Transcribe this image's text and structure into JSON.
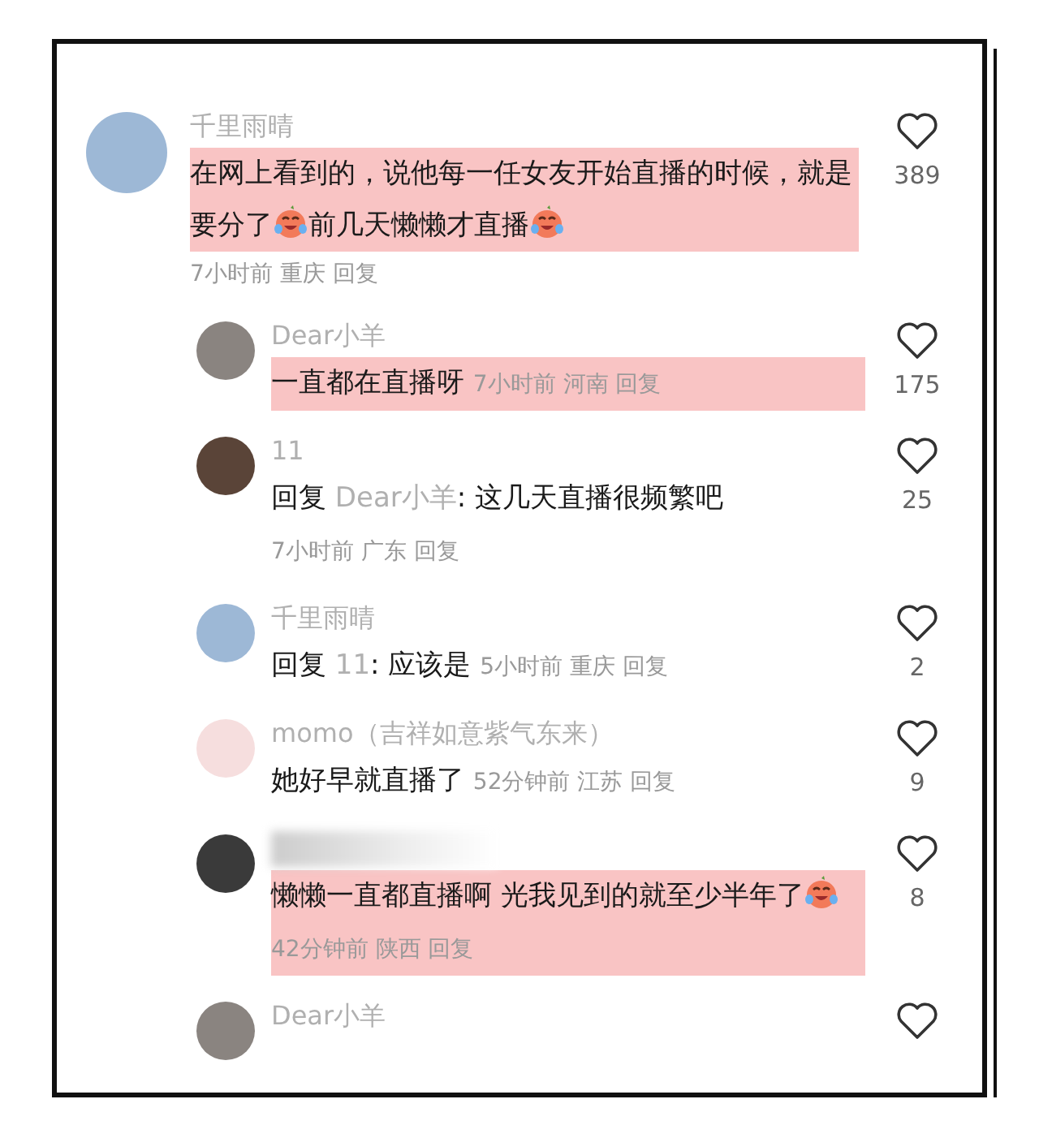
{
  "comments": [
    {
      "user": "千里雨晴",
      "color": "#9db8d6",
      "highlighted": true,
      "segments": [
        {
          "kind": "text",
          "text": "在网上看到的，说他每一任女友开始直播的时候，就是要分了"
        },
        {
          "kind": "emoji"
        },
        {
          "kind": "text",
          "text": "前几天懒懒才直播"
        },
        {
          "kind": "emoji"
        }
      ],
      "time": "7小时前",
      "location": "重庆",
      "reply": "回复",
      "likes": "389",
      "replies": [
        {
          "user": "Dear小羊",
          "color": "#8a8480",
          "highlighted": true,
          "segments": [
            {
              "kind": "text",
              "text": "一直都在直播呀"
            }
          ],
          "time": "7小时前",
          "location": "河南",
          "reply": "回复",
          "likes": "175"
        },
        {
          "user": "11",
          "color": "#5a4438",
          "highlighted": false,
          "segments": [
            {
              "kind": "text",
              "text": "回复 "
            },
            {
              "kind": "mention",
              "text": "Dear小羊"
            },
            {
              "kind": "text",
              "text": ": 这几天直播很频繁吧"
            }
          ],
          "time": "7小时前",
          "location": "广东",
          "reply": "回复",
          "likes": "25"
        },
        {
          "user": "千里雨晴",
          "color": "#9db8d6",
          "highlighted": false,
          "segments": [
            {
              "kind": "text",
              "text": "回复 "
            },
            {
              "kind": "mention",
              "text": "11"
            },
            {
              "kind": "text",
              "text": ": 应该是"
            }
          ],
          "time": "5小时前",
          "location": "重庆",
          "reply": "回复",
          "likes": "2"
        },
        {
          "user": "momo（吉祥如意紫气东来）",
          "color": "#f6dede",
          "highlighted": false,
          "segments": [
            {
              "kind": "text",
              "text": "她好早就直播了"
            }
          ],
          "time": "52分钟前",
          "location": "江苏",
          "reply": "回复",
          "likes": "9"
        },
        {
          "color": "#3a3a3a",
          "highlighted": true,
          "segments": [
            {
              "kind": "text",
              "text": "懒懒一直都直播啊 光我见到的就至少半年了"
            },
            {
              "kind": "emoji"
            }
          ],
          "time": "42分钟前",
          "location": "陕西",
          "reply": "回复",
          "likes": "8"
        },
        {
          "user": "Dear小羊",
          "color": "#8a8480"
        }
      ]
    }
  ]
}
